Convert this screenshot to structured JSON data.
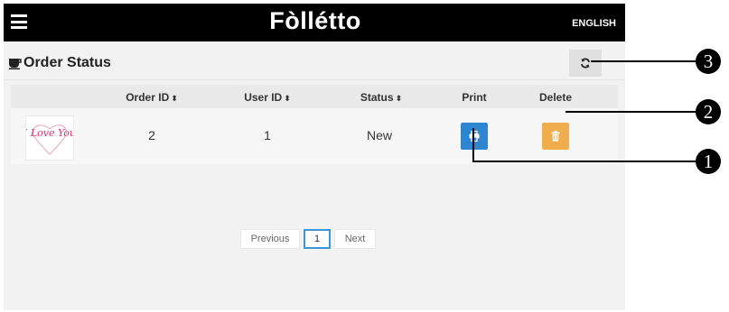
{
  "header": {
    "brand": "Fòllétto",
    "language": "ENGLISH"
  },
  "section": {
    "title": "Order Status"
  },
  "table": {
    "columns": [
      "",
      "Order ID",
      "User ID",
      "Status",
      "Print",
      "Delete"
    ],
    "rows": [
      {
        "order_id": "2",
        "user_id": "1",
        "status": "New",
        "thumbnail_text": "I Love You"
      }
    ]
  },
  "pagination": {
    "previous": "Previous",
    "current": "1",
    "next": "Next"
  },
  "callouts": [
    "1",
    "2",
    "3"
  ],
  "colors": {
    "topbar": "#000000",
    "print_button": "#2f86d0",
    "delete_button": "#f0ad4e",
    "active_page_border": "#3c97d8",
    "thumbnail_text": "#d6336c"
  },
  "icons": {
    "menu": "hamburger-icon",
    "section": "coffee-cup-icon",
    "refresh": "refresh-icon",
    "print": "printer-icon",
    "delete": "trash-icon",
    "sort": "sort-icon"
  }
}
